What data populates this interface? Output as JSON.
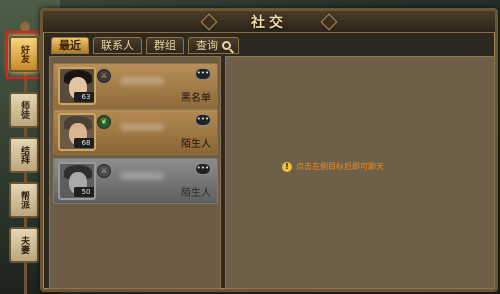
{
  "window": {
    "title": "社交"
  },
  "tabs": [
    {
      "label": "最近",
      "active": true
    },
    {
      "label": "联系人",
      "active": false
    },
    {
      "label": "群组",
      "active": false
    },
    {
      "label": "查询",
      "active": false,
      "icon": "search-icon"
    }
  ],
  "sidebar": [
    {
      "label": "好友",
      "active": true
    },
    {
      "label": "师徒",
      "active": false
    },
    {
      "label": "结拜",
      "active": false
    },
    {
      "label": "帮派",
      "active": false
    },
    {
      "label": "夫妻",
      "active": false
    }
  ],
  "contacts": [
    {
      "level": "63",
      "tag": "黑名单",
      "badge_icon": "sword-icon",
      "name": ""
    },
    {
      "level": "68",
      "tag": "陌生人",
      "badge_icon": "leaf-icon",
      "name": ""
    },
    {
      "level": "50",
      "tag": "陌生人",
      "badge_icon": "sword-icon",
      "name": ""
    }
  ],
  "chat": {
    "tip": "点击左侧目标后即可聊天"
  },
  "colors": {
    "accent": "#f1c96b",
    "tip": "#f08a1c",
    "highlight": "#e02020"
  }
}
